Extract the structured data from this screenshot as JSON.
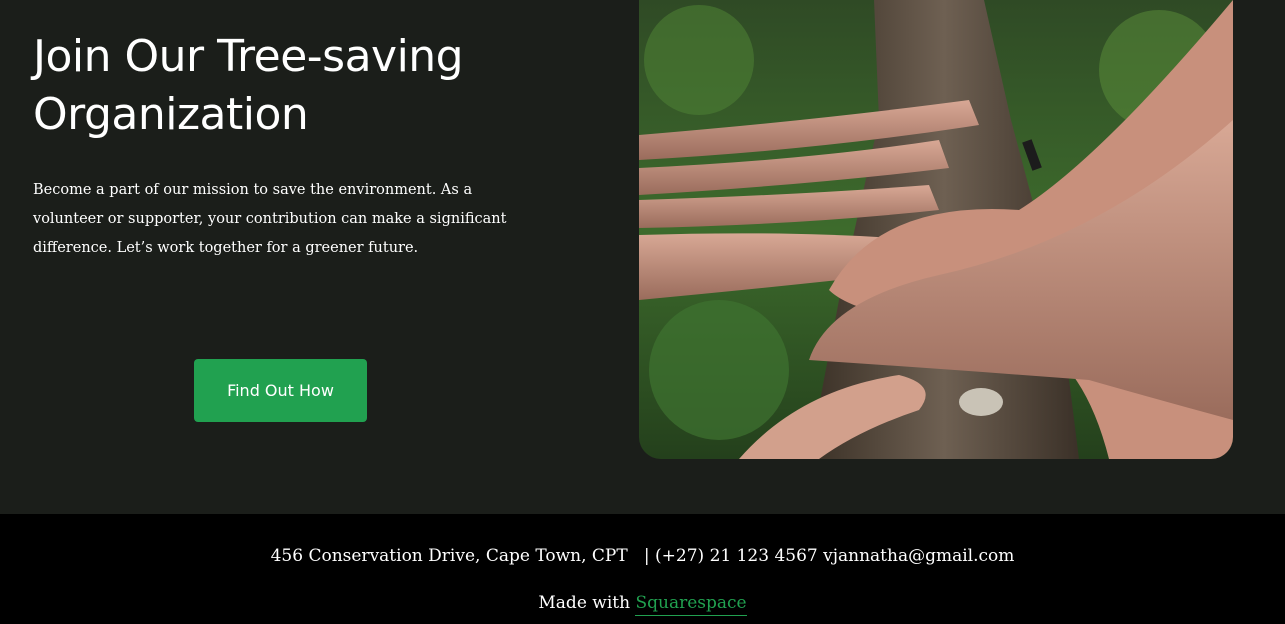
{
  "hero": {
    "title": "Join Our Tree-saving Organization",
    "description": "Become a part of our mission to save the environment. As a volunteer or supporter, your contribution can make a significant difference. Let’s work together for a greener future.",
    "cta_label": "Find Out How"
  },
  "footer": {
    "address": "456 Conservation Drive, Cape Town, CPT",
    "separator": "|",
    "phone": "(+27) 21 123 4567",
    "email": "vjannatha@gmail.com",
    "made_with_label": "Made with",
    "platform_link": "Squarespace"
  },
  "colors": {
    "background": "#1b1e1a",
    "footer_background": "#000000",
    "accent": "#21a150",
    "text": "#ffffff"
  }
}
